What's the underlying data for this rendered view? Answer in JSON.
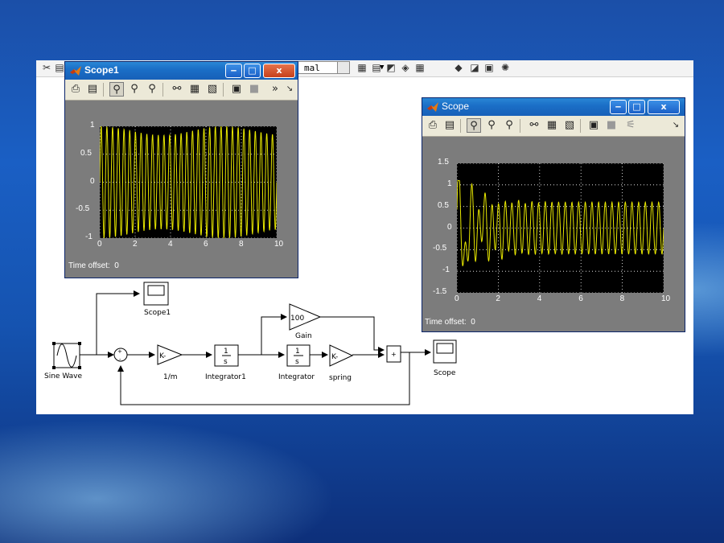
{
  "toolbar": {
    "zoom_value": "mal",
    "icons": [
      "cut-icon",
      "document-icon",
      "library-icon",
      "model-explorer-icon",
      "debug-icon",
      "scissors-icon",
      "grid-icon",
      "build-icon",
      "find-icon",
      "options-icon",
      "help-icon"
    ]
  },
  "scope1": {
    "title": "Scope1",
    "time_offset_label": "Time offset:",
    "time_offset_value": "0",
    "tools": [
      "print-icon",
      "parameters-icon",
      "zoom-icon",
      "zoom-x-icon",
      "zoom-y-icon",
      "autoscale-icon",
      "save-axes-icon",
      "restore-axes-icon",
      "floating-scope-icon",
      "lock-icon",
      "more-icon",
      "dock-icon"
    ],
    "more_label": "»"
  },
  "scope": {
    "title": "Scope",
    "time_offset_label": "Time offset:",
    "time_offset_value": "0",
    "tools": [
      "print-icon",
      "parameters-icon",
      "zoom-icon",
      "zoom-x-icon",
      "zoom-y-icon",
      "autoscale-icon",
      "save-axes-icon",
      "restore-axes-icon",
      "floating-scope-icon",
      "lock-icon",
      "signal-selector-icon",
      "dock-icon"
    ]
  },
  "window_buttons": {
    "minimize": "‒",
    "maximize": "□",
    "close": "x"
  },
  "blocks": {
    "sine_wave": "Sine Wave",
    "scope1": "Scope1",
    "gain_m": "1/m",
    "gain_m_text": "K-",
    "integrator1": "Integrator1",
    "integrator1_num": "1",
    "integrator1_den": "s",
    "gain": "Gain",
    "gain_value": "100",
    "integrator": "Integrator",
    "integrator_num": "1",
    "integrator_den": "s",
    "spring": "spring",
    "spring_text": "K-",
    "sum2_signs": "+",
    "scope": "Scope"
  },
  "chart_data": [
    {
      "type": "line",
      "name": "Scope1",
      "xlim": [
        0,
        10
      ],
      "ylim": [
        -1,
        1
      ],
      "xticks": [
        0,
        2,
        4,
        6,
        8,
        10
      ],
      "yticks": [
        1,
        0.5,
        0,
        -0.5,
        -1
      ],
      "grid": true,
      "series": [
        {
          "color": "#e8e800",
          "function": "sin",
          "amplitude": 1,
          "cycles_in_range": 31
        }
      ]
    },
    {
      "type": "line",
      "name": "Scope",
      "xlim": [
        0,
        10
      ],
      "ylim": [
        -1.5,
        1.5
      ],
      "xticks": [
        0,
        2,
        4,
        6,
        8,
        10
      ],
      "yticks": [
        1.5,
        1,
        0.5,
        0,
        -0.5,
        -1,
        -1.5
      ],
      "grid": true,
      "series": [
        {
          "color": "#e8e800",
          "function": "damped-transient-then-steady",
          "steady_amplitude": 0.6,
          "peak": 1.1,
          "trough": -1.3,
          "cycles_in_range": 31
        }
      ]
    }
  ]
}
